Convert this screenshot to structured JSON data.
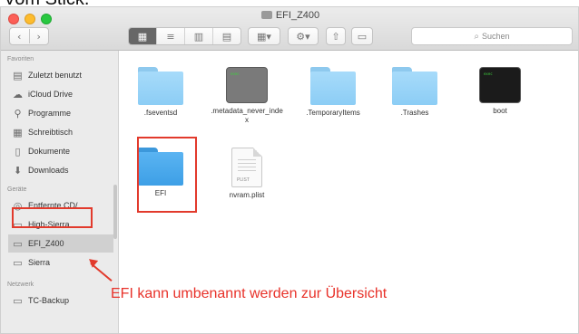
{
  "caption_fragment": "Vom Stick.",
  "window": {
    "title": "EFI_Z400"
  },
  "toolbar": {
    "back_glyph": "‹",
    "forward_glyph": "›",
    "view_modes": [
      "icon-view",
      "list-view",
      "column-view",
      "cover-flow-view"
    ],
    "search_placeholder": "Suchen"
  },
  "sidebar": {
    "favorites_header": "Favoriten",
    "favorites": [
      {
        "label": "Zuletzt benutzt",
        "icon": "clock-icon"
      },
      {
        "label": "iCloud Drive",
        "icon": "cloud-icon"
      },
      {
        "label": "Programme",
        "icon": "applications-icon"
      },
      {
        "label": "Schreibtisch",
        "icon": "desktop-icon"
      },
      {
        "label": "Dokumente",
        "icon": "document-icon"
      },
      {
        "label": "Downloads",
        "icon": "download-icon"
      }
    ],
    "devices_header": "Geräte",
    "devices": [
      {
        "label": "Entfernte CD/...",
        "icon": "cd-icon"
      },
      {
        "label": "High-Sierra",
        "icon": "drive-icon"
      },
      {
        "label": "EFI_Z400",
        "icon": "drive-icon",
        "selected": true
      },
      {
        "label": "Sierra",
        "icon": "drive-icon"
      }
    ],
    "network_header": "Netzwerk",
    "network": [
      {
        "label": "TC-Backup",
        "icon": "network-drive-icon"
      }
    ]
  },
  "files": [
    {
      "name": ".fseventsd",
      "kind": "folder"
    },
    {
      "name": ".metadata_never_index",
      "kind": "terminal-gray",
      "exec_label": "exec"
    },
    {
      "name": ".TemporaryItems",
      "kind": "folder"
    },
    {
      "name": ".Trashes",
      "kind": "folder"
    },
    {
      "name": "boot",
      "kind": "terminal-black",
      "exec_label": "exec"
    },
    {
      "name": "EFI",
      "kind": "folder-dark"
    },
    {
      "name": "nvram.plist",
      "kind": "plist",
      "doc_tag": "PLIST"
    }
  ],
  "annotation": {
    "text": "EFI kann umbenannt werden zur Übersicht",
    "color": "#e23a2c"
  }
}
